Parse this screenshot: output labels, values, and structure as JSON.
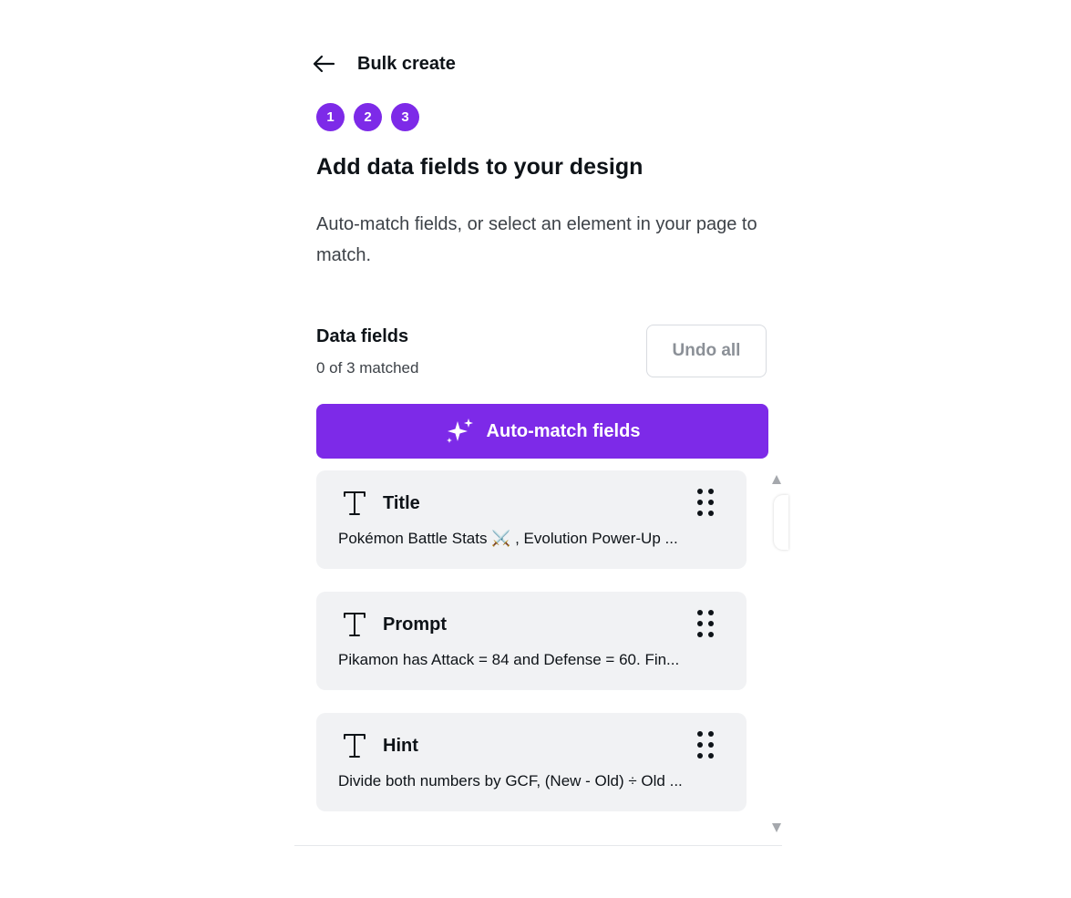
{
  "header": {
    "title": "Bulk create",
    "back_icon": "arrow-left-icon"
  },
  "steps": [
    "1",
    "2",
    "3"
  ],
  "heading": "Add data fields to your design",
  "description": "Auto-match fields, or select an element in your page to match.",
  "data_fields": {
    "title": "Data fields",
    "matched": "0 of 3 matched",
    "undo_label": "Undo all"
  },
  "automatch": {
    "label": "Auto-match fields",
    "icon": "sparkle-icon"
  },
  "fields": [
    {
      "name": "Title",
      "type_icon": "text-type-icon",
      "value": "Pokémon Battle Stats ⚔️ , Evolution Power-Up ..."
    },
    {
      "name": "Prompt",
      "type_icon": "text-type-icon",
      "value": "Pikamon has Attack = 84 and Defense = 60. Fin..."
    },
    {
      "name": "Hint",
      "type_icon": "text-type-icon",
      "value": "Divide both numbers by GCF, (New - Old) ÷ Old ..."
    }
  ],
  "colors": {
    "accent": "#7d2ae8",
    "card_bg": "#f1f2f4",
    "text": "#0e1318",
    "muted": "#3d4248"
  }
}
